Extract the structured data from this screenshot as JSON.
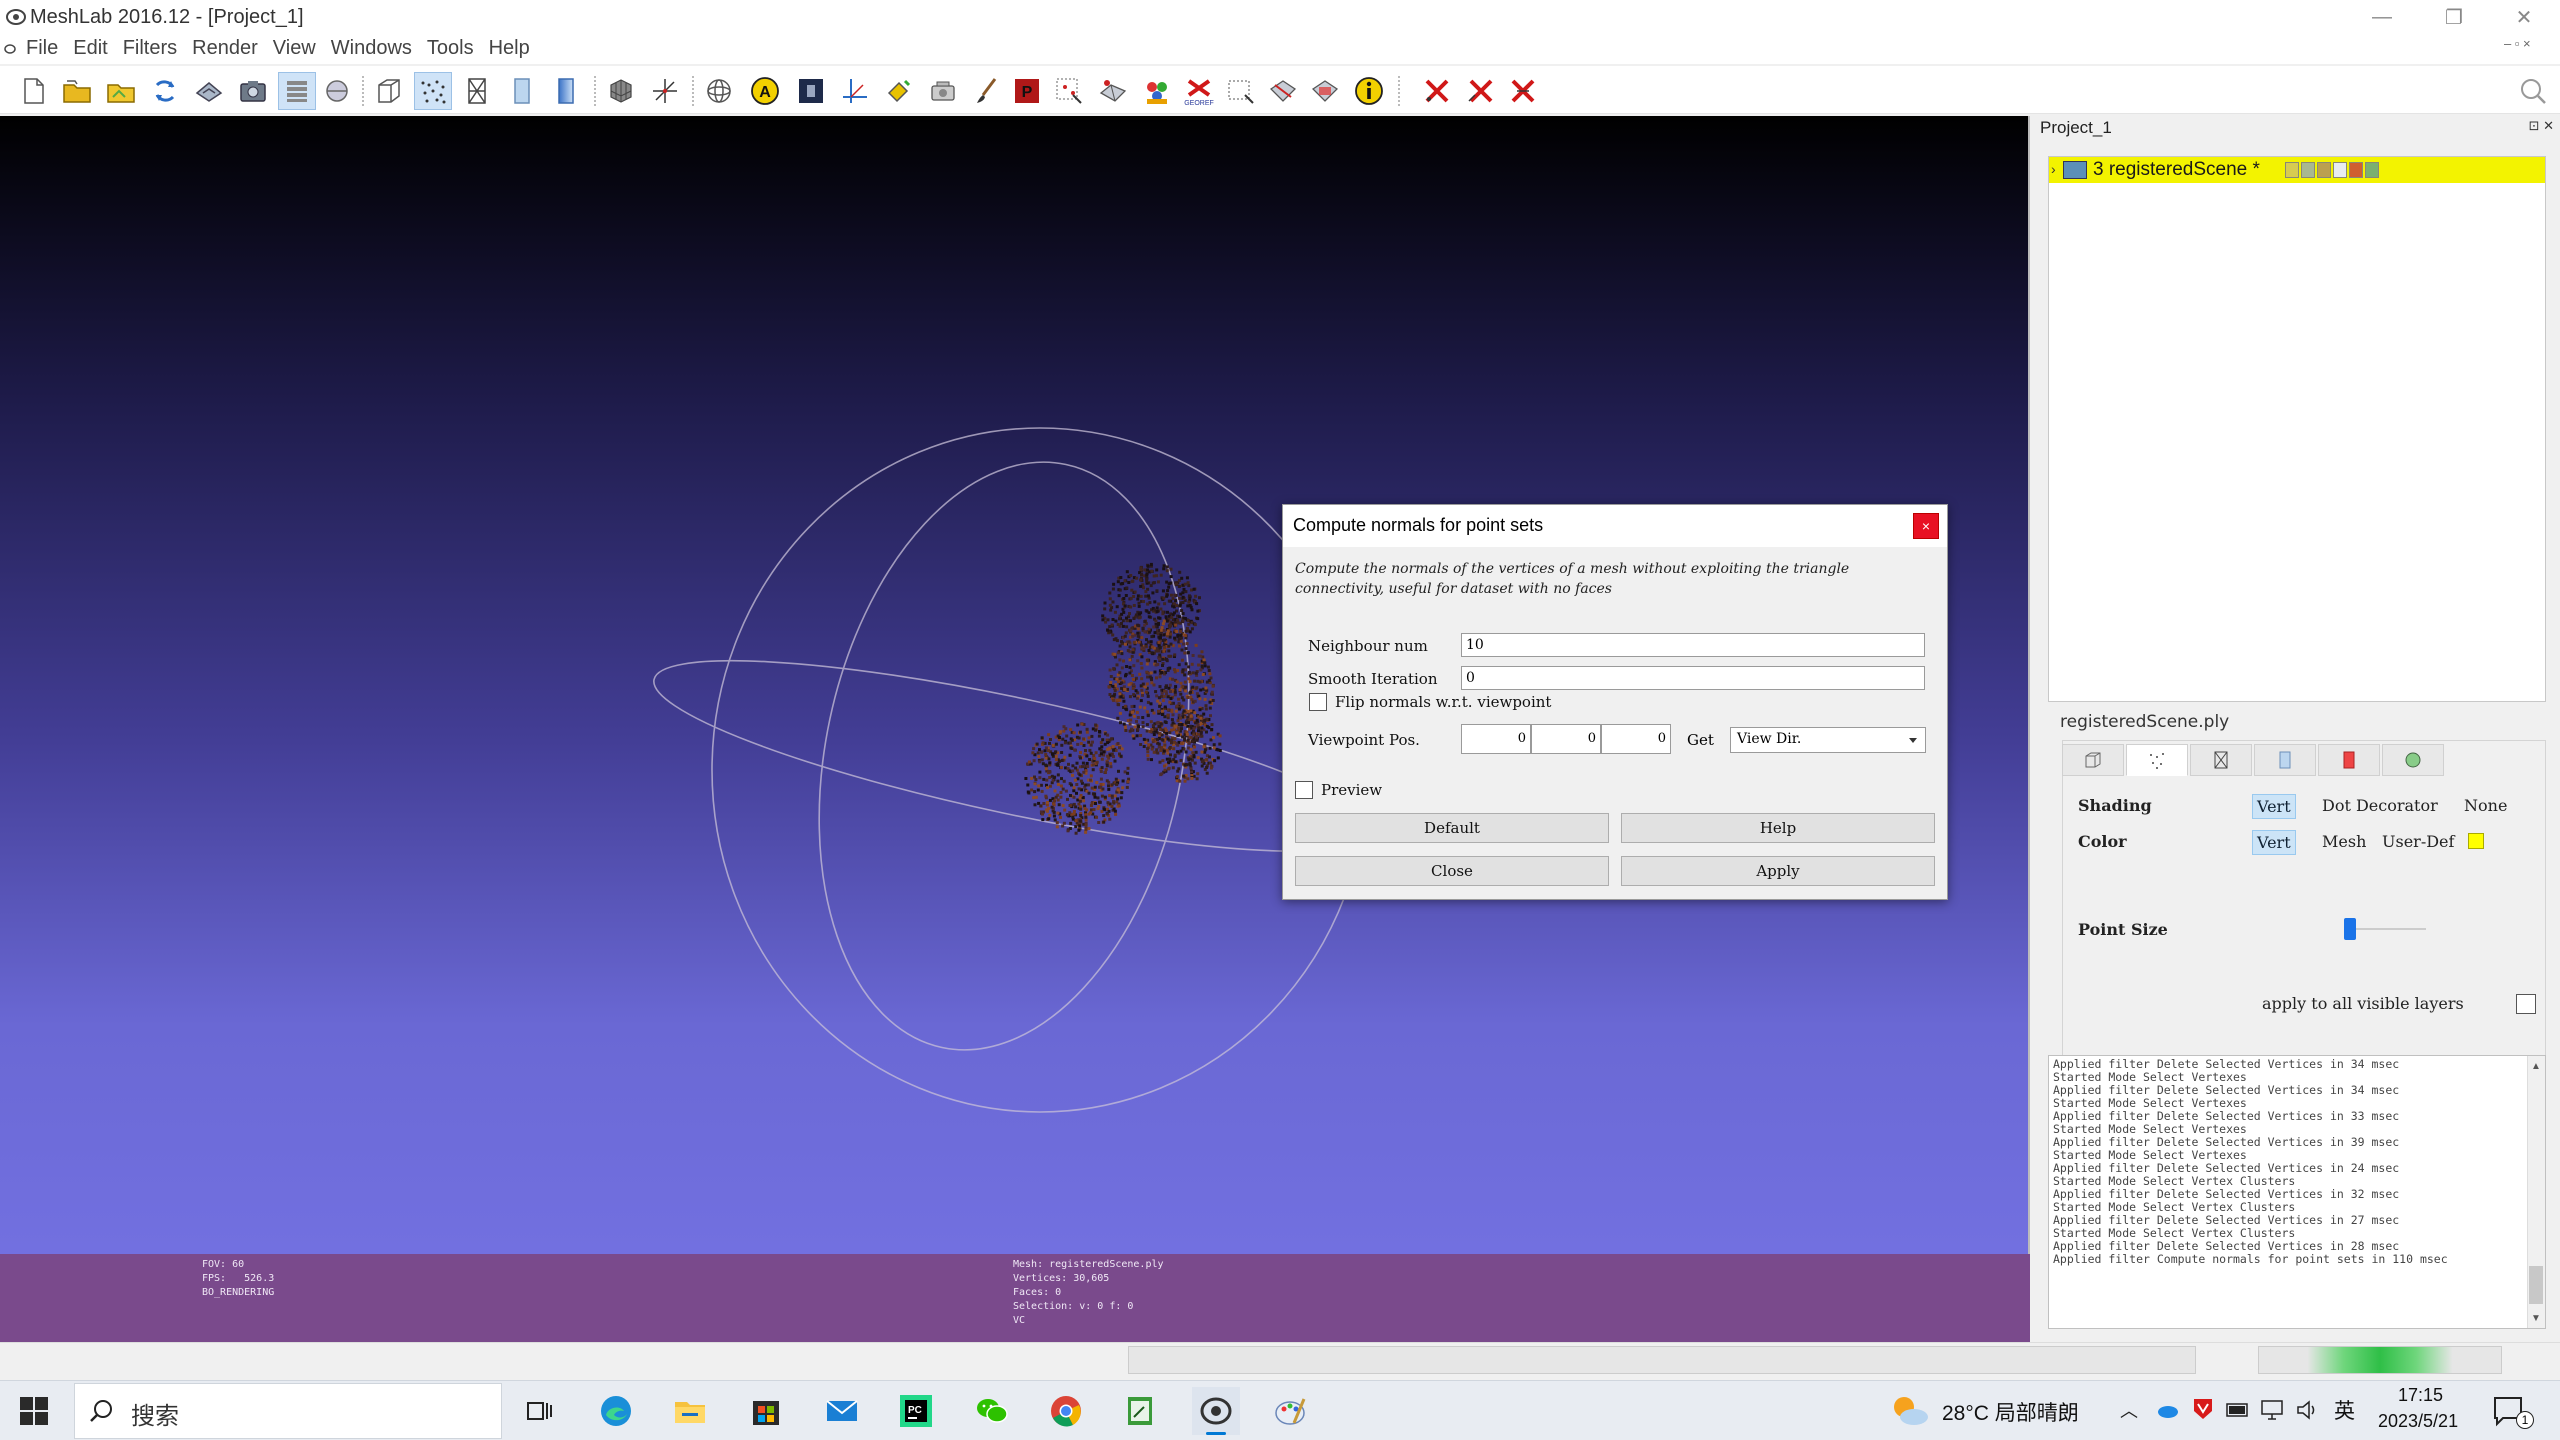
{
  "window": {
    "title": "MeshLab 2016.12 - [Project_1]",
    "minimize_glyph": "—",
    "maximize_glyph": "❐",
    "close_glyph": "✕"
  },
  "menu": {
    "items": [
      "File",
      "Edit",
      "Filters",
      "Render",
      "View",
      "Windows",
      "Tools",
      "Help"
    ],
    "mdi_controls": "– ▫ ×"
  },
  "toolbar": {
    "icons": [
      "new-project-icon",
      "open-project-icon",
      "open-mesh-icon",
      "reload-icon",
      "save-snapshot-icon",
      "snapshot-camera-icon",
      "layers-icon",
      "link-icon",
      "bounding-box-icon",
      "points-icon",
      "wireframe-icon",
      "flat-icon",
      "smooth-icon",
      "grid-icon",
      "axes-icon",
      "trackball-icon",
      "annotation-icon",
      "texture-icon",
      "measure-icon",
      "paint-bucket-icon",
      "render-camera-icon",
      "brush-icon",
      "pdf-icon",
      "select-vertices-icon",
      "select-connected-icon",
      "color-picker-icon",
      "flag-icon",
      "edit-alignment-icon",
      "select-faces-icon",
      "select-edges-icon",
      "select-area-icon",
      "info-icon",
      "delete-vertices-icon",
      "delete-faces-icon",
      "delete-both-icon"
    ]
  },
  "viewport": {
    "info_left": "FOV: 60\nFPS:   526.3\nBO_RENDERING",
    "info_mid": "Mesh: registeredScene.ply\nVertices: 30,605\nFaces: 0\nSelection: v: 0 f: 0\nVC"
  },
  "dialog": {
    "title": "Compute normals for point sets",
    "close_glyph": "×",
    "description": "Compute the normals of the vertices of a mesh without exploiting the triangle connectivity, useful for dataset with no faces",
    "neighbour_label": "Neighbour num",
    "neighbour_value": "10",
    "smooth_label": "Smooth Iteration",
    "smooth_value": "0",
    "flip_label": "Flip normals w.r.t. viewpoint",
    "viewpoint_label": "Viewpoint Pos.",
    "viewpoint_values": [
      "0",
      "0",
      "0"
    ],
    "get_label": "Get",
    "get_option": "View Dir.",
    "preview_label": "Preview",
    "buttons": {
      "default": "Default",
      "help": "Help",
      "close": "Close",
      "apply": "Apply"
    }
  },
  "panel": {
    "project": "Project_1",
    "controls": "⊡ ✕",
    "layer_expander": "›",
    "layer_name": "3 registeredScene *",
    "file_label": "registeredScene.ply",
    "shading_label": "Shading",
    "shading_options": [
      "Vert",
      "Dot Decorator",
      "None"
    ],
    "color_label": "Color",
    "color_options": [
      "Vert",
      "Mesh",
      "User-Def"
    ],
    "user_color": "#ffff00",
    "point_size_label": "Point Size",
    "point_size_level": 0.05,
    "apply_all_label": "apply to all visible layers"
  },
  "log": {
    "lines": [
      "Applied filter Delete Selected Vertices in 34 msec",
      "Started Mode Select Vertexes",
      "Applied filter Delete Selected Vertices in 34 msec",
      "Started Mode Select Vertexes",
      "Applied filter Delete Selected Vertices in 33 msec",
      "Started Mode Select Vertexes",
      "Applied filter Delete Selected Vertices in 39 msec",
      "Started Mode Select Vertexes",
      "Applied filter Delete Selected Vertices in 24 msec",
      "Started Mode Select Vertex Clusters",
      "Applied filter Delete Selected Vertices in 32 msec",
      "Started Mode Select Vertex Clusters",
      "Applied filter Delete Selected Vertices in 27 msec",
      "Started Mode Select Vertex Clusters",
      "Applied filter Delete Selected Vertices in 28 msec",
      "Applied filter Compute normals for point sets in 110 msec"
    ],
    "scroll_up": "▲",
    "scroll_down": "▼"
  },
  "taskbar": {
    "search_text": "搜索",
    "apps": [
      "task-view-icon",
      "edge-icon",
      "file-explorer-icon",
      "store-icon",
      "mail-icon",
      "pycharm-icon",
      "wechat-icon",
      "chrome-icon",
      "notepad-icon",
      "meshlab-icon",
      "paint-icon"
    ],
    "weather": "28°C 局部晴朗",
    "tray_lang": "英",
    "time": "17:15",
    "date": "2023/5/21",
    "notification_count": "1"
  },
  "colors": {
    "viewport_top": "#000000",
    "viewport_bottom": "#7270e0",
    "info_bar": "#7a4a8c",
    "layer_highlight": "#ffff00",
    "dialog_close": "#e81123",
    "selection_blue": "#cce4f7"
  }
}
